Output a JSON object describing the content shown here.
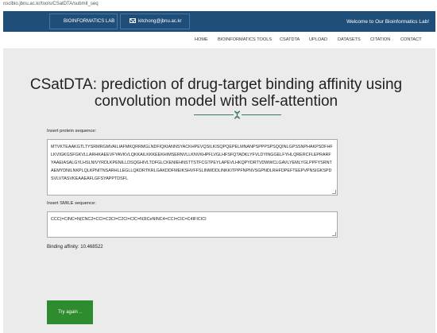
{
  "browser": {
    "url": "nsclbio.jbnu.ac.kr/tools/CSatDTA/submit_seq"
  },
  "topbar": {
    "lab_label": "BIOINFORMATICS LAB",
    "email": "kitchong@jbnu.ac.kr",
    "welcome": "Welcome to Our Bioinformatics Lab!",
    "email_icon": "envelope-icon"
  },
  "nav": {
    "items": [
      "HOME",
      "BIOINFORMATICS TOOLS",
      "CSATDTA",
      "UPLOAD",
      "DATASETS",
      "CITATION",
      "CONTACT"
    ]
  },
  "page": {
    "title_line1": "CSatDTA: prediction of drug-target binding affinity using",
    "title_line2": "convolution model with self-attention",
    "divider_icon": "dna-icon",
    "accent_color": "#3a7a6b"
  },
  "form": {
    "protein_label": "Insert protein sequence:",
    "protein_value": "MTVKTEAAKGTLTYSRMRGMVAILIAFMKQRRMGLNDFIQKIANNSYACKHPEVQSILKISQPQEPELMNANPSPPPSPSQQINLGPSSNPHAKPSDFHFLKVIGKGSFGKVLLARHKAEEVFYAVKVLQKKAILKKKEEKHIMSERNVLLKNVKHPFLVGLHFSFQTADKLYFVLDYINGGELFYHLQRERCFLEPRARFYAAEIASALGYLHSLNIVYRDLKPENILLDSQGHIVLTDFGLCKENIEHNSTTSTFCGTPEYLAPEVLHKQPYDRTVDWWCLGAVLYEMLYGLPPFYSRNTAEMYDNILNKPLQLKPNITNSARHLLEGLLQKDRTKRLGAKDDFMEIKSHVFFSLINWDDLINKKITPPFNPNVSGPNDLRHFDPEFTEEPVPNSIGKSPDSVLVTASVKEAAEAFLGFSYAPPTDSFL",
    "smile_label": "Insert SMILE sequence:",
    "smile_value": "CCC(=CINC=N(CNC2=CCI=C3CI=C2CI=CIC=N3ICeNINC4=CCI=CIC=C4IFICICI",
    "result_text": "Binding affinity: 10.468522",
    "submit_label": "Try again .."
  },
  "colors": {
    "topbar": "#1f4e79",
    "content_bg": "#ebebeb",
    "button": "#2e8b2e"
  }
}
